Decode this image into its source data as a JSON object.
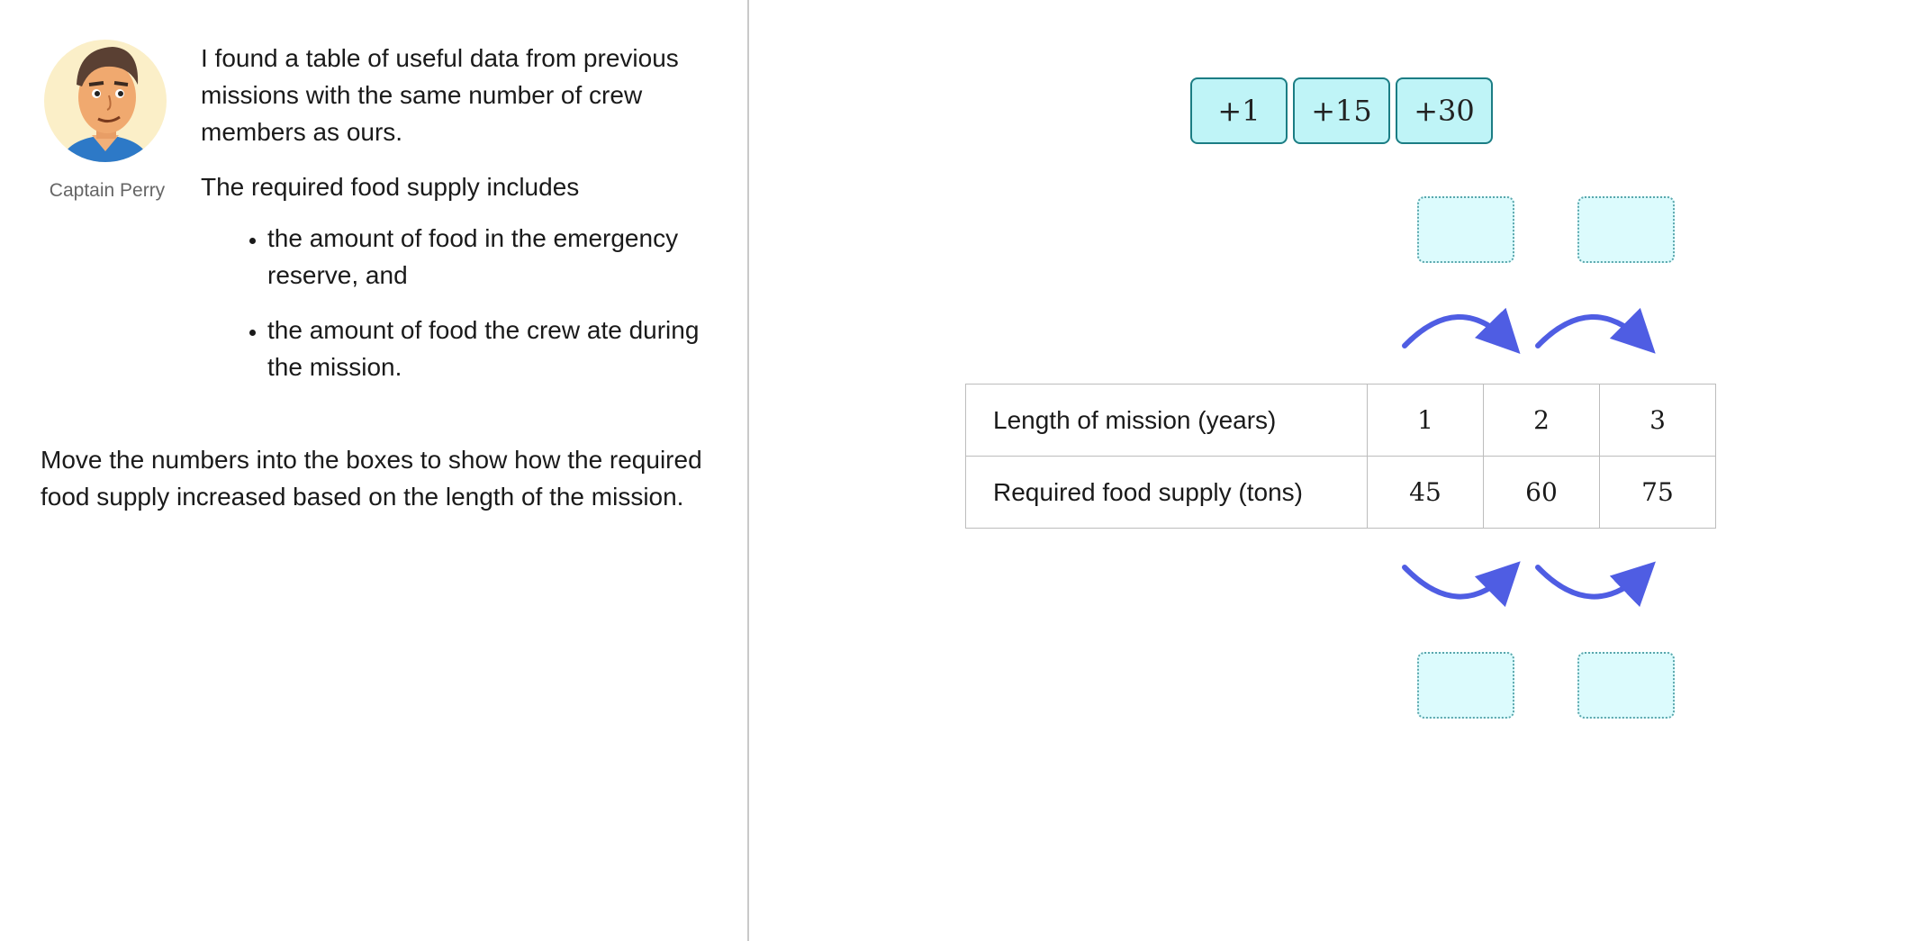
{
  "speaker": {
    "name": "Captain Perry",
    "avatar_icon": "captain-avatar"
  },
  "speech": {
    "intro": "I found a table of useful data from previous missions with the same number of crew members as ours.",
    "includes": "The required food supply includes",
    "bullets": [
      "the amount of food in the emergency reserve, and",
      "the amount of food the crew ate during the mission."
    ]
  },
  "instruction": "Move the numbers into the boxes to show how the required food supply increased based on the length of the mission.",
  "tiles": [
    "+1",
    "+15",
    "+30"
  ],
  "table": {
    "rows": [
      {
        "label": "Length of mission (years)",
        "values": [
          "1",
          "2",
          "3"
        ]
      },
      {
        "label": "Required food supply (tons)",
        "values": [
          "45",
          "60",
          "75"
        ]
      }
    ]
  },
  "colors": {
    "arrow": "#4f5de3",
    "tile_fill": "#bff4f7",
    "tile_border": "#1b7d84",
    "drop_fill": "#dcfbfd"
  }
}
